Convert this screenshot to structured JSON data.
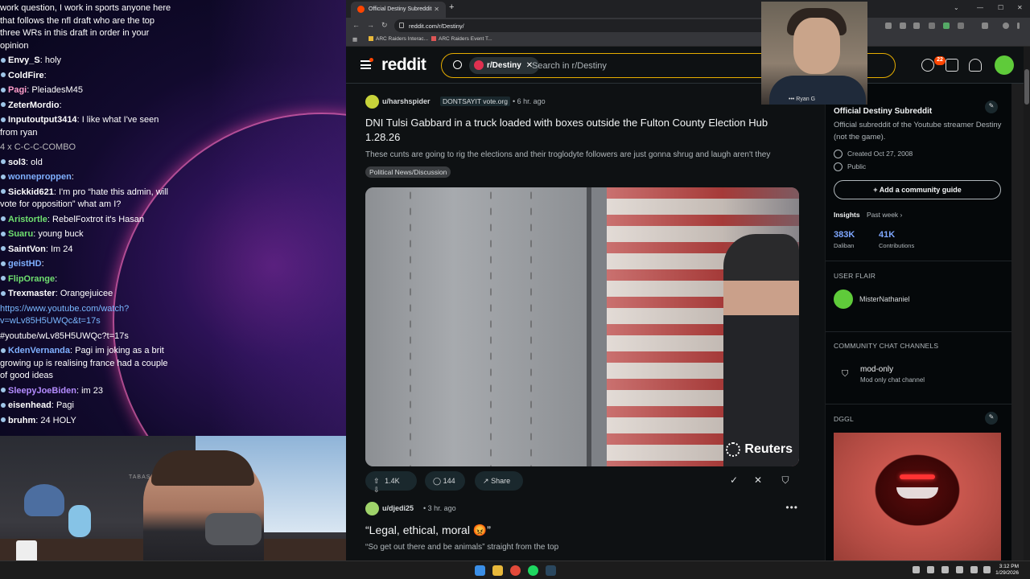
{
  "chat": {
    "messages": [
      {
        "user": "",
        "text": "work question, I work in sports anyone here that follows the nfl draft who are the top three WRs in this draft in order in your opinion",
        "color": "#ffffff"
      },
      {
        "user": "Envy_S",
        "text": "holy",
        "color": "#ffffff"
      },
      {
        "user": "ColdFire",
        "text": "",
        "color": "#ffffff"
      },
      {
        "user": "Pagi",
        "text": "PleiadesM45",
        "color": "#ff9ecb"
      },
      {
        "user": "ZeterMordio",
        "text": "",
        "color": "#ffffff"
      },
      {
        "user": "Inputoutput3414",
        "text": "I like what I've seen from ryan",
        "color": "#ffffff"
      },
      {
        "user": "",
        "text": "4 x C-C-C-COMBO",
        "color": "#bbbbbb"
      },
      {
        "user": "sol3",
        "text": "old",
        "color": "#ffffff"
      },
      {
        "user": "wonneproppen",
        "text": "",
        "color": "#7fb0ff"
      },
      {
        "user": "Sickkid621",
        "text": "I'm pro “hate this admin, will vote for opposition” what am I?",
        "color": "#ffffff"
      },
      {
        "user": "Aristortle",
        "text": "RebelFoxtrot it's Hasan",
        "color": "#6fe06f"
      },
      {
        "user": "Suaru",
        "text": "young buck",
        "color": "#6fe06f"
      },
      {
        "user": "SaintVon",
        "text": "Im 24",
        "color": "#ffffff"
      },
      {
        "user": "geistHD",
        "text": "",
        "color": "#7fb0ff"
      },
      {
        "user": "FlipOrange",
        "text": "",
        "color": "#6fe06f"
      },
      {
        "user": "Trexmaster",
        "text": "Orangejuicee",
        "color": "#ffffff"
      },
      {
        "user": "",
        "text": "https://www.youtube.com/watch?v=wLv85H5UWQc&t=17s",
        "color": "#79b8ff"
      },
      {
        "user": "",
        "text": "#youtube/wLv85H5UWQc?t=17s",
        "color": "#ffffff"
      },
      {
        "user": "KdenVernanda",
        "text": "Pagi im joking as a brit growing up is realising france had a couple of good ideas",
        "color": "#7fb0ff"
      },
      {
        "user": "SleepyJoeBiden",
        "text": "im 23",
        "color": "#b48cff"
      },
      {
        "user": "eisenhead",
        "text": "Pagi",
        "color": "#ffffff"
      },
      {
        "user": "bruhm",
        "text": "24 HOLY",
        "color": "#ffffff"
      }
    ]
  },
  "webcam": {
    "label": "TABASA"
  },
  "browser": {
    "tab_title": "Official Destiny Subreddit",
    "url": "reddit.com/r/Destiny/",
    "bookmarks": [
      "ARC Raiders Interac...",
      "ARC Raiders Event T..."
    ]
  },
  "reddit": {
    "logo": "reddit",
    "search_chip": "r/Destiny",
    "search_placeholder": "Search in r/Destiny",
    "notif_count": "22",
    "overlay_name": "Ryan G",
    "posts": [
      {
        "user": "u/harshspider",
        "flair": "DONTSAYIT vote.org",
        "time": "• 6 hr. ago",
        "title": "DNI Tulsi Gabbard in a truck loaded with boxes outside the Fulton County Election Hub 1.28.26",
        "body": "These cunts are going to rig the elections and their troglodyte followers are just gonna shrug and laugh aren't they",
        "tag": "Political News/Discussion",
        "watermark": "Reuters",
        "votes": "1.4K",
        "comments": "144",
        "share": "Share"
      },
      {
        "user": "u/djedi25",
        "time": "• 3 hr. ago",
        "title": "“Legal, ethical, moral 😡”",
        "body": "“So get out there and be animals” straight from the top"
      }
    ],
    "sidebar": {
      "title": "Official Destiny Subreddit",
      "description": "Official subreddit of the Youtube streamer Destiny (not the game).",
      "created": "Created Oct 27, 2008",
      "visibility": "Public",
      "guide_button": "Add a community guide",
      "insights": "Insights",
      "insights_period": "Past week ›",
      "stat1_value": "383K",
      "stat1_label": "Daliban",
      "stat2_value": "41K",
      "stat2_label": "Contributions",
      "user_flair_heading": "USER FLAIR",
      "user_flair_name": "MisterNathaniel",
      "chat_heading": "COMMUNITY CHAT CHANNELS",
      "channel_name": "mod-only",
      "channel_desc": "Mod only chat channel",
      "dggl_heading": "DGGL"
    }
  },
  "taskbar": {
    "time": "3:12 PM",
    "date": "1/29/2026"
  }
}
